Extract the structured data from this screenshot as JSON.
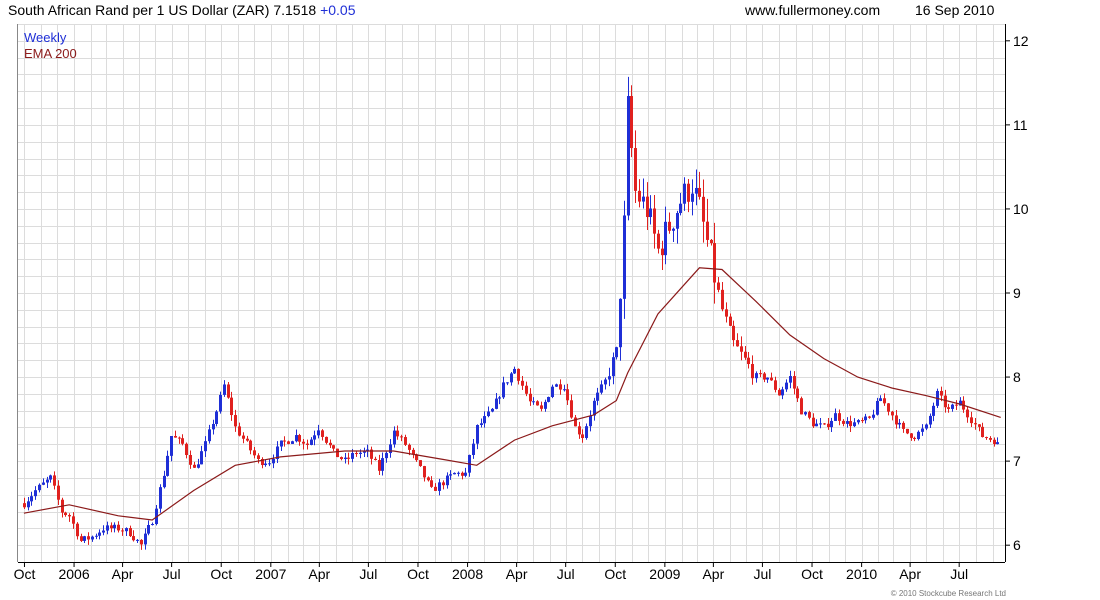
{
  "header": {
    "title": "South African Rand per 1 US Dollar (ZAR)",
    "last_price": "7.1518",
    "change": "+0.05",
    "website": "www.fullermoney.com",
    "date": "16 Sep 2010"
  },
  "footer": {
    "copyright": "© 2010 Stockcube Research Ltd"
  },
  "colors": {
    "up_candle": "#1f2fd6",
    "down_candle": "#e0211f",
    "ema_line": "#8b1a1a",
    "grid": "#dcdcdc",
    "weekly_legend": "#1f2fd6",
    "ema_legend": "#8b1a1a"
  },
  "chart_data": {
    "type": "candlestick",
    "frequency": "Weekly",
    "legend": [
      {
        "name": "Weekly",
        "color": "#1f2fd6"
      },
      {
        "name": "EMA 200",
        "color": "#8b1a1a"
      }
    ],
    "legend_position": "top-left",
    "grid": true,
    "y_axis_side": "right",
    "ylim": [
      5.8,
      12.2
    ],
    "y_ticks": [
      6,
      7,
      8,
      9,
      10,
      11,
      12
    ],
    "x_ticks": [
      "Oct",
      "2006",
      "Apr",
      "Jul",
      "Oct",
      "2007",
      "Apr",
      "Jul",
      "Oct",
      "2008",
      "Apr",
      "Jul",
      "Oct",
      "2009",
      "Apr",
      "Jul",
      "Oct",
      "2010",
      "Apr",
      "Jul"
    ],
    "close_path": [
      [
        "2005-09-30",
        6.5
      ],
      [
        "2005-10-21",
        6.65
      ],
      [
        "2005-11-18",
        6.8
      ],
      [
        "2005-12-09",
        6.4
      ],
      [
        "2005-12-23",
        6.35
      ],
      [
        "2006-01-13",
        6.05
      ],
      [
        "2006-02-03",
        6.1
      ],
      [
        "2006-02-24",
        6.2
      ],
      [
        "2006-03-24",
        6.2
      ],
      [
        "2006-04-14",
        6.15
      ],
      [
        "2006-05-05",
        6.0
      ],
      [
        "2006-05-26",
        6.3
      ],
      [
        "2006-06-16",
        6.85
      ],
      [
        "2006-06-30",
        7.3
      ],
      [
        "2006-07-21",
        7.2
      ],
      [
        "2006-08-11",
        6.9
      ],
      [
        "2006-09-01",
        7.2
      ],
      [
        "2006-09-22",
        7.6
      ],
      [
        "2006-10-06",
        7.9
      ],
      [
        "2006-10-27",
        7.4
      ],
      [
        "2006-11-17",
        7.2
      ],
      [
        "2006-12-08",
        7.0
      ],
      [
        "2006-12-29",
        7.0
      ],
      [
        "2007-01-19",
        7.2
      ],
      [
        "2007-02-16",
        7.3
      ],
      [
        "2007-03-09",
        7.2
      ],
      [
        "2007-03-30",
        7.4
      ],
      [
        "2007-04-27",
        7.1
      ],
      [
        "2007-05-18",
        7.0
      ],
      [
        "2007-06-08",
        7.1
      ],
      [
        "2007-06-29",
        7.1
      ],
      [
        "2007-07-20",
        6.9
      ],
      [
        "2007-08-17",
        7.35
      ],
      [
        "2007-09-07",
        7.2
      ],
      [
        "2007-10-05",
        6.9
      ],
      [
        "2007-10-26",
        6.65
      ],
      [
        "2007-11-16",
        6.75
      ],
      [
        "2007-12-07",
        6.85
      ],
      [
        "2007-12-28",
        6.85
      ],
      [
        "2008-01-18",
        7.4
      ],
      [
        "2008-02-15",
        7.6
      ],
      [
        "2008-03-07",
        7.9
      ],
      [
        "2008-03-28",
        8.1
      ],
      [
        "2008-04-25",
        7.7
      ],
      [
        "2008-05-16",
        7.6
      ],
      [
        "2008-06-06",
        7.9
      ],
      [
        "2008-06-27",
        7.9
      ],
      [
        "2008-07-18",
        7.4
      ],
      [
        "2008-08-01",
        7.3
      ],
      [
        "2008-08-22",
        7.7
      ],
      [
        "2008-09-12",
        7.95
      ],
      [
        "2008-10-03",
        8.3
      ],
      [
        "2008-10-17",
        9.8
      ],
      [
        "2008-10-24",
        11.2
      ],
      [
        "2008-11-07",
        10.2
      ],
      [
        "2008-11-28",
        10.0
      ],
      [
        "2008-12-19",
        9.5
      ],
      [
        "2009-01-09",
        9.8
      ],
      [
        "2009-01-30",
        10.1
      ],
      [
        "2009-02-20",
        10.3
      ],
      [
        "2009-03-06",
        10.0
      ],
      [
        "2009-03-27",
        9.4
      ],
      [
        "2009-04-17",
        8.8
      ],
      [
        "2009-05-08",
        8.4
      ],
      [
        "2009-05-29",
        8.2
      ],
      [
        "2009-06-19",
        8.0
      ],
      [
        "2009-07-10",
        8.0
      ],
      [
        "2009-07-31",
        7.8
      ],
      [
        "2009-08-21",
        8.0
      ],
      [
        "2009-09-11",
        7.6
      ],
      [
        "2009-10-02",
        7.45
      ],
      [
        "2009-10-23",
        7.4
      ],
      [
        "2009-11-13",
        7.55
      ],
      [
        "2009-12-04",
        7.45
      ],
      [
        "2009-12-25",
        7.45
      ],
      [
        "2010-01-15",
        7.5
      ],
      [
        "2010-02-05",
        7.75
      ],
      [
        "2010-02-26",
        7.55
      ],
      [
        "2010-03-19",
        7.35
      ],
      [
        "2010-04-09",
        7.3
      ],
      [
        "2010-04-30",
        7.4
      ],
      [
        "2010-05-21",
        7.8
      ],
      [
        "2010-06-11",
        7.6
      ],
      [
        "2010-07-02",
        7.7
      ],
      [
        "2010-07-23",
        7.5
      ],
      [
        "2010-08-13",
        7.3
      ],
      [
        "2010-09-03",
        7.25
      ],
      [
        "2010-09-16",
        7.15
      ]
    ],
    "ema_200": [
      [
        "2005-09-30",
        6.38
      ],
      [
        "2005-12-23",
        6.48
      ],
      [
        "2006-03-24",
        6.35
      ],
      [
        "2006-05-26",
        6.3
      ],
      [
        "2006-08-11",
        6.65
      ],
      [
        "2006-10-27",
        6.95
      ],
      [
        "2007-01-19",
        7.05
      ],
      [
        "2007-05-18",
        7.12
      ],
      [
        "2007-08-17",
        7.12
      ],
      [
        "2007-11-16",
        7.02
      ],
      [
        "2008-01-18",
        6.95
      ],
      [
        "2008-03-28",
        7.25
      ],
      [
        "2008-06-06",
        7.42
      ],
      [
        "2008-08-22",
        7.55
      ],
      [
        "2008-10-03",
        7.72
      ],
      [
        "2008-10-24",
        8.05
      ],
      [
        "2008-12-19",
        8.75
      ],
      [
        "2009-01-30",
        9.05
      ],
      [
        "2009-03-06",
        9.3
      ],
      [
        "2009-04-17",
        9.28
      ],
      [
        "2009-06-19",
        8.9
      ],
      [
        "2009-08-21",
        8.5
      ],
      [
        "2009-10-23",
        8.22
      ],
      [
        "2009-12-25",
        8.0
      ],
      [
        "2010-02-26",
        7.87
      ],
      [
        "2010-04-30",
        7.78
      ],
      [
        "2010-07-02",
        7.68
      ],
      [
        "2010-09-16",
        7.52
      ]
    ]
  }
}
